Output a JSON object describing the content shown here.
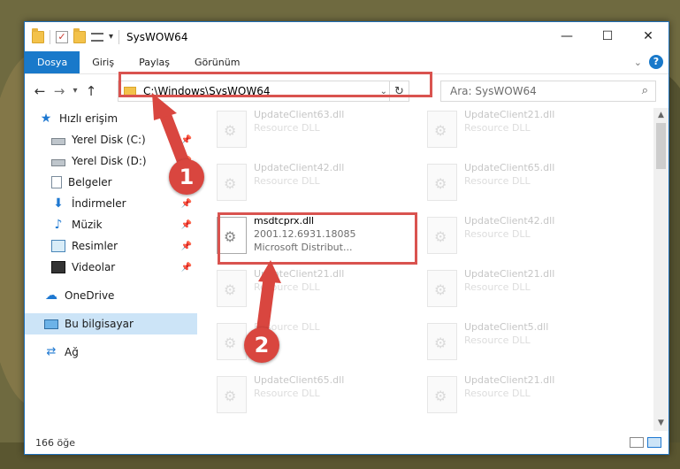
{
  "titlebar": {
    "title": "SysWOW64",
    "controls": {
      "minimize": "—",
      "maximize": "☐",
      "close": "✕"
    }
  },
  "ribbon": {
    "tabs": [
      "Dosya",
      "Giriş",
      "Paylaş",
      "Görünüm"
    ],
    "help": "?"
  },
  "address": {
    "path": "C:\\Windows\\SysWOW64",
    "search_placeholder": "Ara: SysWOW64"
  },
  "nav": {
    "items": [
      {
        "label": "Hızlı erişim",
        "icon": "star-icon"
      },
      {
        "label": "Yerel Disk (C:)",
        "icon": "disk-icon",
        "pinned": true
      },
      {
        "label": "Yerel Disk (D:)",
        "icon": "disk-icon",
        "pinned": true
      },
      {
        "label": "Belgeler",
        "icon": "document-icon",
        "pinned": false
      },
      {
        "label": "İndirmeler",
        "icon": "download-icon",
        "pinned": true
      },
      {
        "label": "Müzik",
        "icon": "music-icon",
        "pinned": true
      },
      {
        "label": "Resimler",
        "icon": "pictures-icon",
        "pinned": true
      },
      {
        "label": "Videolar",
        "icon": "videos-icon",
        "pinned": true
      },
      {
        "label": "OneDrive",
        "icon": "cloud-icon"
      },
      {
        "label": "Bu bilgisayar",
        "icon": "computer-icon",
        "selected": true
      },
      {
        "label": "Ağ",
        "icon": "network-icon"
      }
    ]
  },
  "files": {
    "col1": [
      {
        "name": "UpdateClient63.dll",
        "desc": "Resource DLL"
      },
      {
        "name": "UpdateClient42.dll",
        "desc": "Resource DLL"
      },
      {
        "name": "msdtcprx.dll",
        "version": "2001.12.6931.18085",
        "desc": "Microsoft Distribut..."
      },
      {
        "name": "UpdateClient21.dll",
        "desc": "Resource DLL"
      },
      {
        "name": "",
        "desc": "Resource DLL"
      },
      {
        "name": "UpdateClient65.dll",
        "desc": "Resource DLL"
      }
    ],
    "col2": [
      {
        "name": "UpdateClient21.dll",
        "desc": "Resource DLL"
      },
      {
        "name": "UpdateClient65.dll",
        "desc": "Resource DLL"
      },
      {
        "name": "UpdateClient42.dll",
        "desc": "Resource DLL"
      },
      {
        "name": "UpdateClient21.dll",
        "desc": "Resource DLL"
      },
      {
        "name": "UpdateClient5.dll",
        "desc": "Resource DLL"
      },
      {
        "name": "UpdateClient21.dll",
        "desc": "Resource DLL"
      }
    ]
  },
  "status": {
    "count": "166 öğe"
  },
  "badges": {
    "one": "1",
    "two": "2"
  },
  "colors": {
    "accent": "#1979ca",
    "highlight": "#d9534f",
    "badge": "#d9463f"
  }
}
